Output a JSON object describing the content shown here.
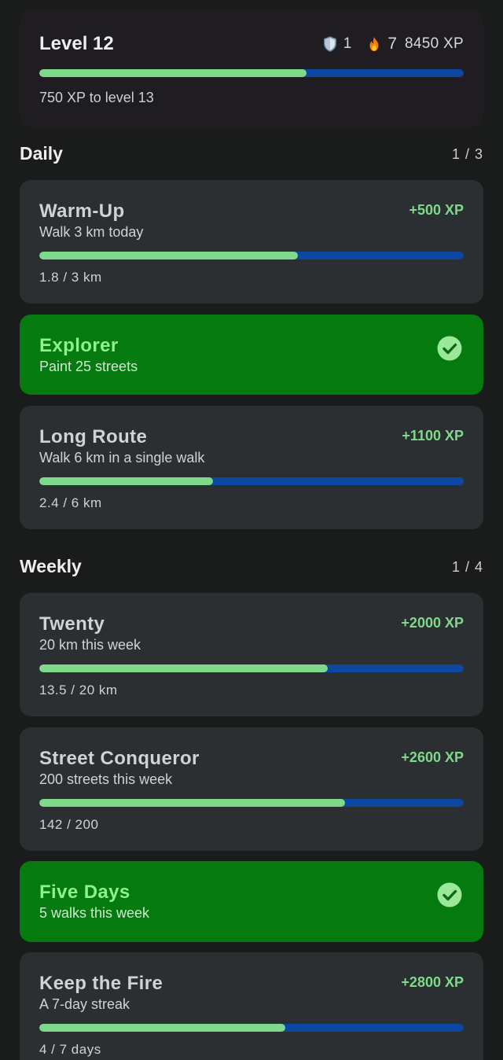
{
  "header": {
    "level_title": "Level 12",
    "shields": "1",
    "streak": "7",
    "xp_total": "8450 XP",
    "xp_to_next": "750 XP to level 13",
    "level_progress": 0.63,
    "icons": {
      "shield": "shield-icon",
      "fire": "fire-icon"
    }
  },
  "colors": {
    "progress_fill": "#7fd98a",
    "progress_remaining": "#0d47a1",
    "card_bg": "#2b2f31",
    "completed_bg": "#047a0f",
    "reward_text": "#7fd98a"
  },
  "daily": {
    "title": "Daily",
    "count": "1 / 3",
    "challenges": [
      {
        "title": "Warm-Up",
        "desc": "Walk 3 km today",
        "reward": "+500 XP",
        "progress_text": "1.8 / 3 km",
        "progress": 0.61
      },
      {
        "title": "Explorer",
        "desc": "Paint 25 streets",
        "completed": true,
        "icon": "check-circle-icon"
      },
      {
        "title": "Long Route",
        "desc": "Walk 6 km in a single walk",
        "reward": "+1100 XP",
        "progress_text": "2.4 / 6 km",
        "progress": 0.41
      }
    ]
  },
  "weekly": {
    "title": "Weekly",
    "count": "1 / 4",
    "challenges": [
      {
        "title": "Twenty",
        "desc": "20 km this week",
        "reward": "+2000 XP",
        "progress_text": "13.5 / 20 km",
        "progress": 0.68
      },
      {
        "title": "Street Conqueror",
        "desc": "200 streets this week",
        "reward": "+2600 XP",
        "progress_text": "142 / 200",
        "progress": 0.72
      },
      {
        "title": "Five Days",
        "desc": "5 walks this week",
        "completed": true,
        "icon": "check-circle-icon"
      },
      {
        "title": "Keep the Fire",
        "desc": "A 7-day streak",
        "reward": "+2800 XP",
        "progress_text": "4 / 7 days",
        "progress": 0.58
      }
    ]
  }
}
